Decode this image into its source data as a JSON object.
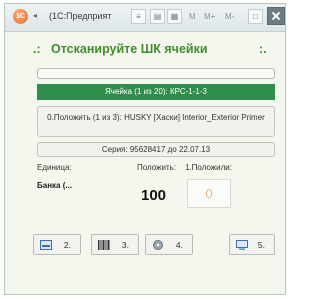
{
  "window": {
    "app_icon_text": "1C",
    "title": "(1С:Предприят",
    "titlebar_buttons": [
      "M",
      "M+",
      "M-"
    ]
  },
  "header": {
    "left_marks": ".:",
    "title": "Отсканируйте ШК ячейки",
    "right_marks": ":."
  },
  "progress": {
    "fraction": 0
  },
  "cell": {
    "label": "Ячейка (1 из 20): КРС-1-1-3"
  },
  "item": {
    "label": "0.Положить (1 из 3): HUSKY [Хаски] Interior_Exterior Primer"
  },
  "series": {
    "label": "Серия: 95628417 до 22.07.13"
  },
  "quantities": {
    "unit_label": "Единица:",
    "put_label": "Положить:",
    "put_done_label": "1.Положили:",
    "unit_value": "Банка (...",
    "put_value": "100",
    "put_done_value": "0"
  },
  "actions": [
    {
      "label": "2.",
      "icon": "card-icon"
    },
    {
      "label": "3.",
      "icon": "barcode-icon"
    },
    {
      "label": "4.",
      "icon": "disc-icon"
    },
    {
      "label": "5.",
      "icon": "monitor-icon"
    }
  ],
  "colors": {
    "title_green": "#3f8f2b",
    "cell_bar_green": "#2f8e4c",
    "field_digit": "#e3b98a"
  }
}
